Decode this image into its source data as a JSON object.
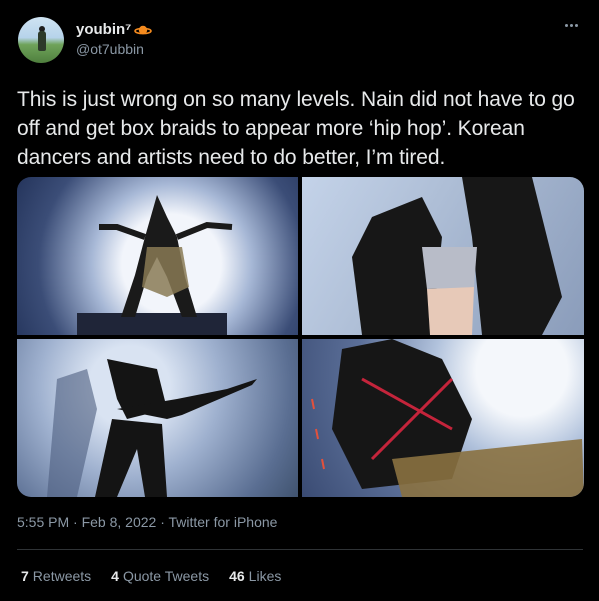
{
  "tweet": {
    "display_name": "youbin⁷",
    "handle": "@ot7ubbin",
    "text": "This is just wrong on so many levels. Nain did not have to go off and get box braids to appear more ‘hip hop’. Korean dancers and artists need to do better, I’m tired.",
    "meta": "5:55 PM · Feb 8, 2022 · Twitter for iPhone",
    "stats": {
      "retweets_count": "7",
      "retweets_label": "Retweets",
      "quotes_count": "4",
      "quotes_label": "Quote Tweets",
      "likes_count": "46",
      "likes_label": "Likes"
    }
  },
  "icons": {
    "name_badge": "planet-icon",
    "more": "more-icon"
  },
  "colors": {
    "background": "#000000",
    "text": "#e7e9ea",
    "secondary": "#8b98a5",
    "divider": "#2f3336",
    "planet": "#f58b1f"
  }
}
